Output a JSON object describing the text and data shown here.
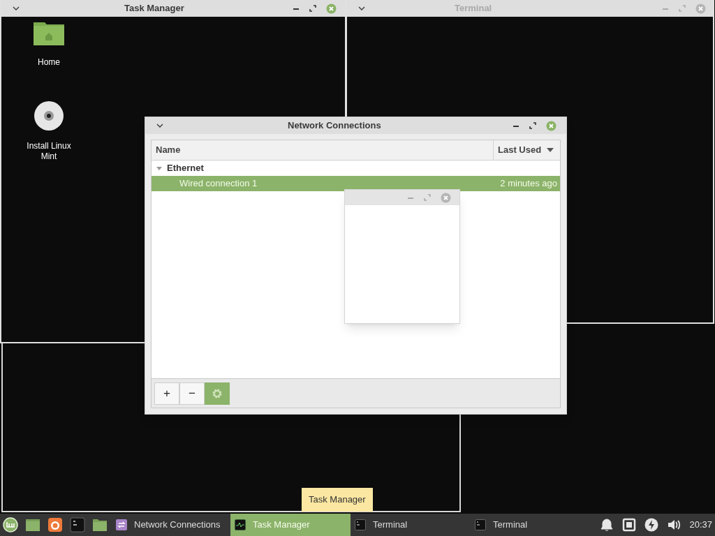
{
  "desktop_icons": [
    {
      "kind": "folder",
      "label": "Home"
    },
    {
      "kind": "disc",
      "label": "Install Linux Mint"
    }
  ],
  "windows": [
    {
      "kind": "terminal",
      "title": "Terminal",
      "active": false
    },
    {
      "kind": "frame"
    },
    {
      "kind": "task_manager",
      "title": "Task Manager",
      "active": true
    },
    {
      "kind": "network",
      "title": "Network Connections",
      "active": true,
      "columns": [
        {
          "label": "Name",
          "sorted": false
        },
        {
          "label": "Last Used",
          "sorted": true
        }
      ],
      "groups": [
        {
          "label": "Ethernet",
          "expanded": true,
          "children": [
            {
              "name": "Wired connection 1",
              "last_used": "2 minutes ago",
              "selected": true
            }
          ]
        }
      ],
      "buttons": [
        {
          "kind": "add",
          "label": "+"
        },
        {
          "kind": "remove",
          "label": "−"
        },
        {
          "kind": "settings"
        }
      ]
    },
    {
      "kind": "dialog",
      "active": false
    }
  ],
  "tooltip": "Task Manager",
  "taskbar": {
    "launchers": [
      {
        "kind": "menu"
      },
      {
        "kind": "desktop"
      },
      {
        "kind": "browser"
      },
      {
        "kind": "terminal"
      },
      {
        "kind": "files"
      }
    ],
    "windows": [
      {
        "kind": "network",
        "label": "Network Connections",
        "selected": false
      },
      {
        "kind": "task_manager",
        "label": "Task Manager",
        "selected": true
      },
      {
        "kind": "terminal",
        "label": "Terminal",
        "selected": false
      },
      {
        "kind": "terminal",
        "label": "Terminal",
        "selected": false
      }
    ],
    "tray": [
      {
        "kind": "bell"
      },
      {
        "kind": "network"
      },
      {
        "kind": "power"
      },
      {
        "kind": "volume"
      }
    ],
    "clock": "20:37"
  }
}
